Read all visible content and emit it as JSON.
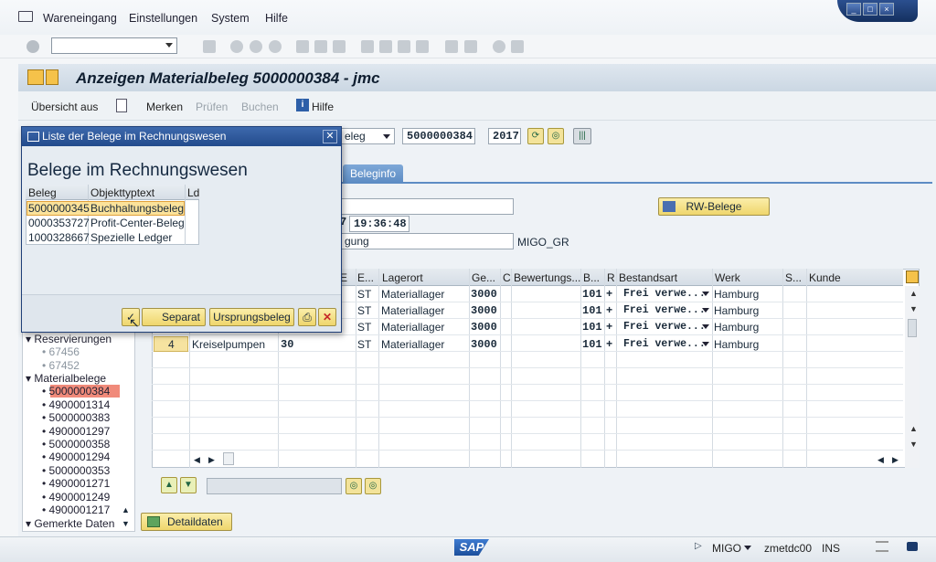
{
  "menu": {
    "items": [
      "Wareneingang",
      "Einstellungen",
      "System",
      "Hilfe"
    ]
  },
  "window": {
    "title": "Anzeigen Materialbeleg 5000000384 - jmc"
  },
  "app_toolbar": {
    "overview": "Übersicht aus",
    "remember": "Merken",
    "check": "Prüfen",
    "post": "Buchen",
    "help": "Hilfe"
  },
  "header_fields": {
    "doc_type_value": "eleg",
    "doc_number": "5000000384",
    "year": "2017",
    "time": "19:36:48",
    "time_prefix": "7",
    "text_fragment": "gung",
    "migo_label": "MIGO_GR"
  },
  "tabs": {
    "beleginfo": "Beleginfo"
  },
  "rw_button": "RW-Belege",
  "grid": {
    "columns": [
      "E",
      "E...",
      "Lagerort",
      "Ge...",
      "C",
      "Bewertungs...",
      "B...",
      "R",
      "Bestandsart",
      "Werk",
      "S...",
      "Kunde"
    ],
    "rows": [
      {
        "pos": "",
        "material": "",
        "qty": "",
        "unit": "ST",
        "lagerort": "Materiallager",
        "ge": "3000",
        "b": "101",
        "r": "+",
        "bestandsart": "Frei verwe...",
        "werk": "Hamburg"
      },
      {
        "pos": "",
        "material": "",
        "qty": "",
        "unit": "ST",
        "lagerort": "Materiallager",
        "ge": "3000",
        "b": "101",
        "r": "+",
        "bestandsart": "Frei verwe...",
        "werk": "Hamburg"
      },
      {
        "pos": "",
        "material": "",
        "qty": "",
        "unit": "ST",
        "lagerort": "Materiallager",
        "ge": "3000",
        "b": "101",
        "r": "+",
        "bestandsart": "Frei verwe...",
        "werk": "Hamburg"
      },
      {
        "pos": "4",
        "material": "Kreiselpumpen",
        "qty": "30",
        "unit": "ST",
        "lagerort": "Materiallager",
        "ge": "3000",
        "b": "101",
        "r": "+",
        "bestandsart": "Frei verwe...",
        "werk": "Hamburg"
      }
    ]
  },
  "tree": {
    "reservierungen": "Reservierungen",
    "res_items": [
      "67456",
      "67452"
    ],
    "materialbelege": "Materialbelege",
    "mat_items": [
      "5000000384",
      "4900001314",
      "5000000383",
      "4900001297",
      "5000000358",
      "4900001294",
      "5000000353",
      "4900001271",
      "4900001249",
      "4900001217"
    ],
    "gemerkte": "Gemerkte Daten"
  },
  "detail_button": "Detaildaten",
  "status": {
    "transaction": "MIGO",
    "server": "zmetdc00",
    "mode": "INS",
    "logo": "SAP"
  },
  "popup": {
    "title": "Liste der Belege im Rechnungswesen",
    "heading": "Belege im Rechnungswesen",
    "columns": [
      "Beleg",
      "Objekttyptext",
      "Ld"
    ],
    "rows": [
      {
        "beleg": "5000000345",
        "text": "Buchhaltungsbeleg"
      },
      {
        "beleg": "0000353727",
        "text": "Profit-Center-Beleg"
      },
      {
        "beleg": "1000328667",
        "text": "Spezielle Ledger"
      }
    ],
    "buttons": {
      "separat": "Separat",
      "origin": "Ursprungsbeleg"
    }
  }
}
